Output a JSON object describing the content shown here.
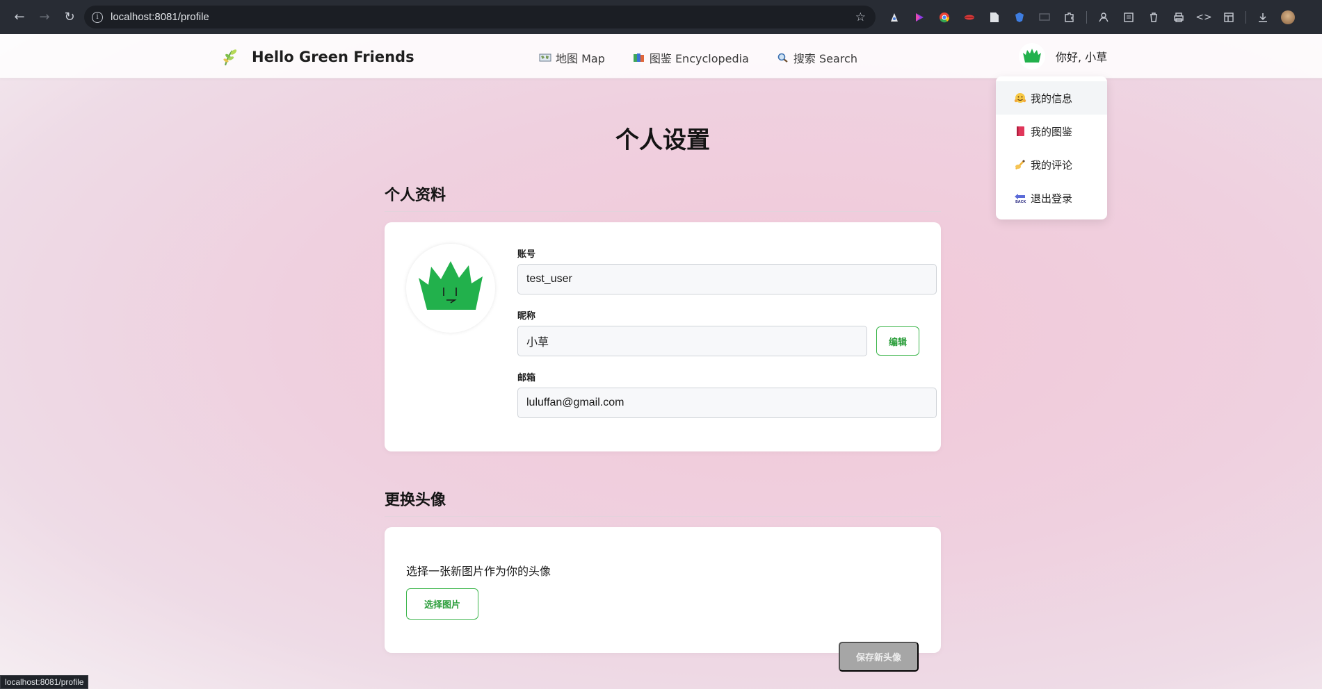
{
  "browser": {
    "url": "localhost:8081/profile",
    "status_url": "localhost:8081/profile"
  },
  "nav": {
    "brand": "Hello Green Friends",
    "links": [
      {
        "label": "地图 Map",
        "icon": "world-map-icon"
      },
      {
        "label": "图鉴 Encyclopedia",
        "icon": "books-icon"
      },
      {
        "label": "搜索 Search",
        "icon": "magnifier-icon"
      }
    ],
    "greeting": "你好, 小草"
  },
  "dropdown": {
    "items": [
      {
        "label": "我的信息",
        "icon": "hugging-face-icon"
      },
      {
        "label": "我的图鉴",
        "icon": "red-book-icon"
      },
      {
        "label": "我的评论",
        "icon": "writing-hand-icon"
      },
      {
        "label": "退出登录",
        "icon": "back-arrow-icon"
      }
    ]
  },
  "page": {
    "title": "个人设置",
    "profile_section": "个人资料",
    "avatar_section": "更换头像"
  },
  "profile": {
    "account_label": "账号",
    "account_value": "test_user",
    "nickname_label": "昵称",
    "nickname_value": "小草",
    "edit_button": "编辑",
    "email_label": "邮箱",
    "email_value": "luluffan@gmail.com"
  },
  "avatar_upload": {
    "description": "选择一张新图片作为你的头像",
    "choose_button": "选择图片",
    "save_button": "保存新头像"
  },
  "colors": {
    "accent_green": "#3bb54a",
    "avatar_green": "#22b14c",
    "disabled_gray": "#a6a6a6"
  }
}
